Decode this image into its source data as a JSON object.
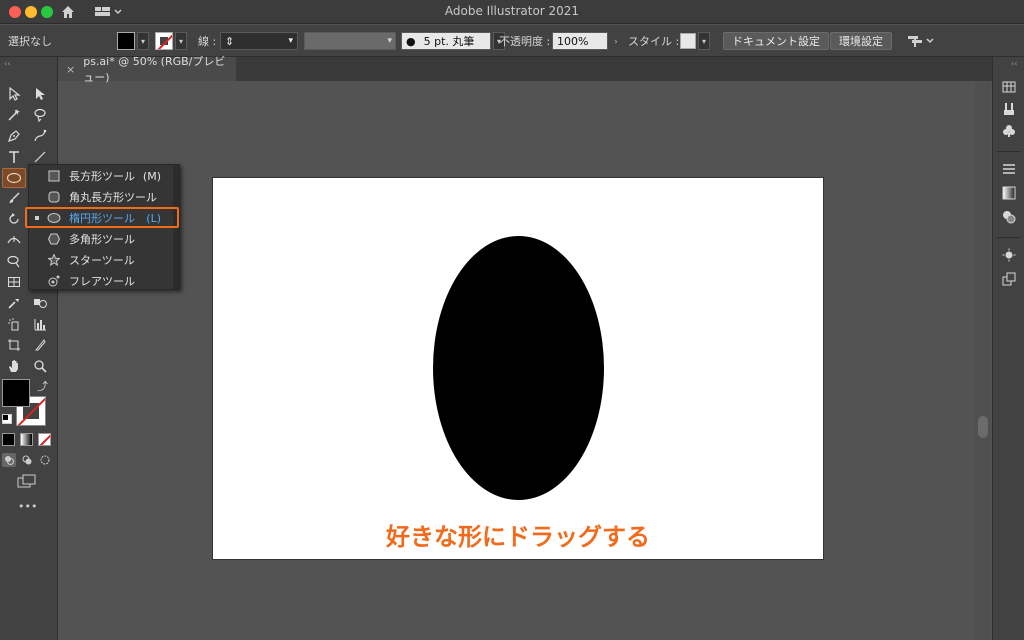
{
  "window": {
    "title": "Adobe Illustrator 2021"
  },
  "control_bar": {
    "selection_label": "選択なし",
    "stroke_label": "線 :",
    "brush_value": "5 pt. 丸筆",
    "opacity_label": "不透明度 :",
    "opacity_value": "100%",
    "style_label": "スタイル :",
    "document_setup_button": "ドキュメント設定",
    "preferences_button": "環境設定"
  },
  "tab": {
    "close_glyph": "×",
    "label": "ps.ai* @ 50% (RGB/プレビュー)"
  },
  "flyout": {
    "items": [
      {
        "label": "長方形ツール",
        "shortcut": "(M)",
        "icon": "rectangle-icon"
      },
      {
        "label": "角丸長方形ツール",
        "shortcut": "",
        "icon": "rounded-rectangle-icon"
      },
      {
        "label": "楕円形ツール",
        "shortcut": "(L)",
        "icon": "ellipse-icon",
        "active": true
      },
      {
        "label": "多角形ツール",
        "shortcut": "",
        "icon": "polygon-icon"
      },
      {
        "label": "スターツール",
        "shortcut": "",
        "icon": "star-icon"
      },
      {
        "label": "フレアツール",
        "shortcut": "",
        "icon": "flare-icon"
      }
    ]
  },
  "canvas": {
    "instruction": "好きな形にドラッグする",
    "instruction_color": "#f26a1b",
    "ellipse_fill": "#000000"
  },
  "colors": {
    "highlight": "#f26a1b",
    "active_item": "#5aa8f0"
  },
  "more_tools_glyph": "•••"
}
